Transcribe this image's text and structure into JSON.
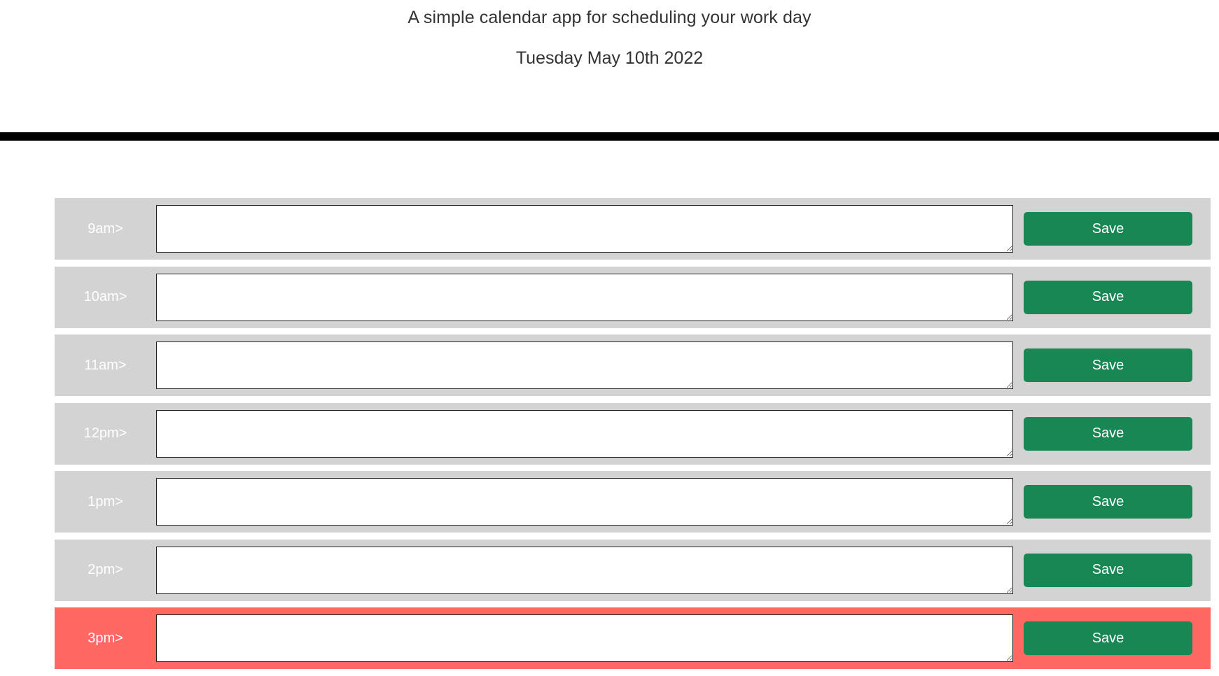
{
  "header": {
    "tagline": "A simple calendar app for scheduling your work day",
    "current_day": "Tuesday May 10th 2022"
  },
  "colors": {
    "past": "#d3d3d3",
    "present": "#ff6961",
    "save_button": "#198754",
    "divider": "#000000"
  },
  "time_blocks": [
    {
      "hour": "9am>",
      "status": "past",
      "text": "",
      "save_label": "Save"
    },
    {
      "hour": "10am>",
      "status": "past",
      "text": "",
      "save_label": "Save"
    },
    {
      "hour": "11am>",
      "status": "past",
      "text": "",
      "save_label": "Save"
    },
    {
      "hour": "12pm>",
      "status": "past",
      "text": "",
      "save_label": "Save"
    },
    {
      "hour": "1pm>",
      "status": "past",
      "text": "",
      "save_label": "Save"
    },
    {
      "hour": "2pm>",
      "status": "past",
      "text": "",
      "save_label": "Save"
    },
    {
      "hour": "3pm>",
      "status": "present",
      "text": "",
      "save_label": "Save"
    }
  ]
}
